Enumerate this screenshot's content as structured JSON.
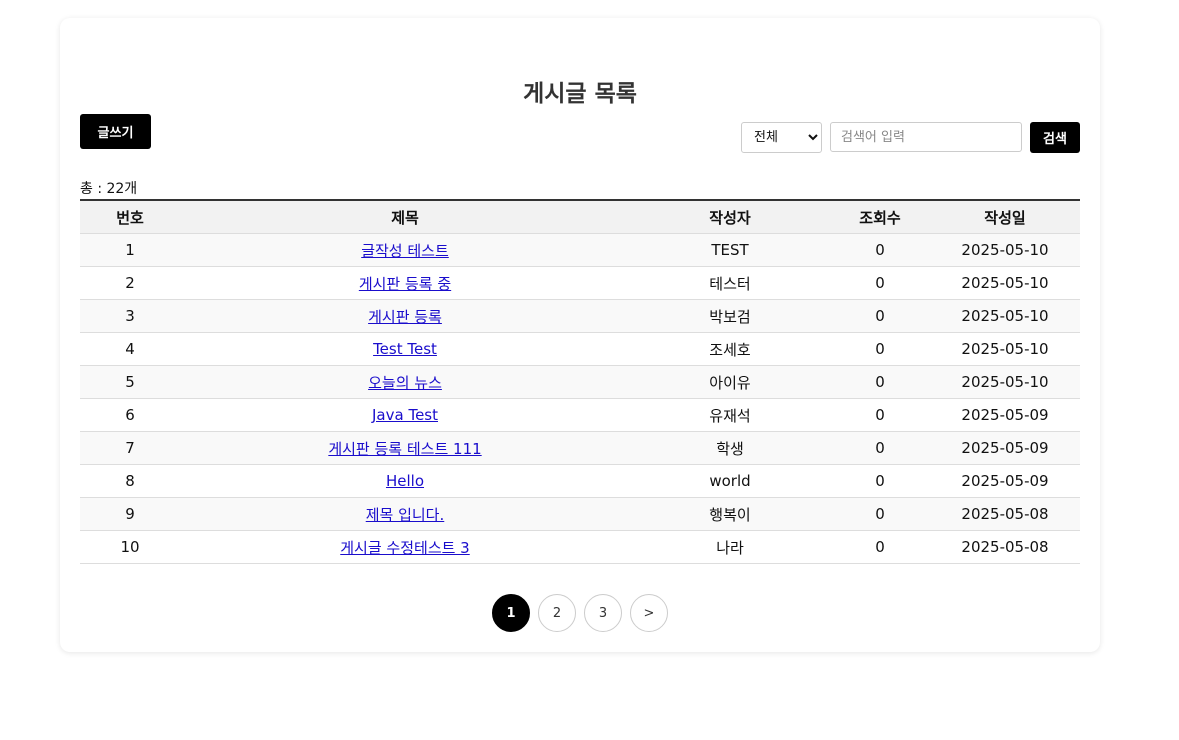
{
  "page": {
    "title": "게시글 목록",
    "write_button": "글쓰기",
    "total_text": "총 : 22개"
  },
  "search": {
    "selected_option": "전체",
    "placeholder": "검색어 입력",
    "value": "",
    "button": "검색"
  },
  "table": {
    "headers": [
      "번호",
      "제목",
      "작성자",
      "조회수",
      "작성일"
    ],
    "rows": [
      {
        "no": "1",
        "title": "글작성 테스트",
        "author": "TEST",
        "views": "0",
        "date": "2025-05-10"
      },
      {
        "no": "2",
        "title": "게시판 등록 중",
        "author": "테스터",
        "views": "0",
        "date": "2025-05-10"
      },
      {
        "no": "3",
        "title": "게시판 등록",
        "author": "박보검",
        "views": "0",
        "date": "2025-05-10"
      },
      {
        "no": "4",
        "title": "Test Test",
        "author": "조세호",
        "views": "0",
        "date": "2025-05-10"
      },
      {
        "no": "5",
        "title": "오늘의 뉴스",
        "author": "아이유",
        "views": "0",
        "date": "2025-05-10"
      },
      {
        "no": "6",
        "title": "Java Test",
        "author": "유재석",
        "views": "0",
        "date": "2025-05-09"
      },
      {
        "no": "7",
        "title": "게시판 등록 테스트 111",
        "author": "학생",
        "views": "0",
        "date": "2025-05-09"
      },
      {
        "no": "8",
        "title": "Hello",
        "author": "world",
        "views": "0",
        "date": "2025-05-09"
      },
      {
        "no": "9",
        "title": "제목 입니다.",
        "author": "행복이",
        "views": "0",
        "date": "2025-05-08"
      },
      {
        "no": "10",
        "title": "게시글 수정테스트 3",
        "author": "나라",
        "views": "0",
        "date": "2025-05-08"
      }
    ]
  },
  "pagination": {
    "pages": [
      "1",
      "2",
      "3"
    ],
    "current": "1",
    "next": ">"
  }
}
